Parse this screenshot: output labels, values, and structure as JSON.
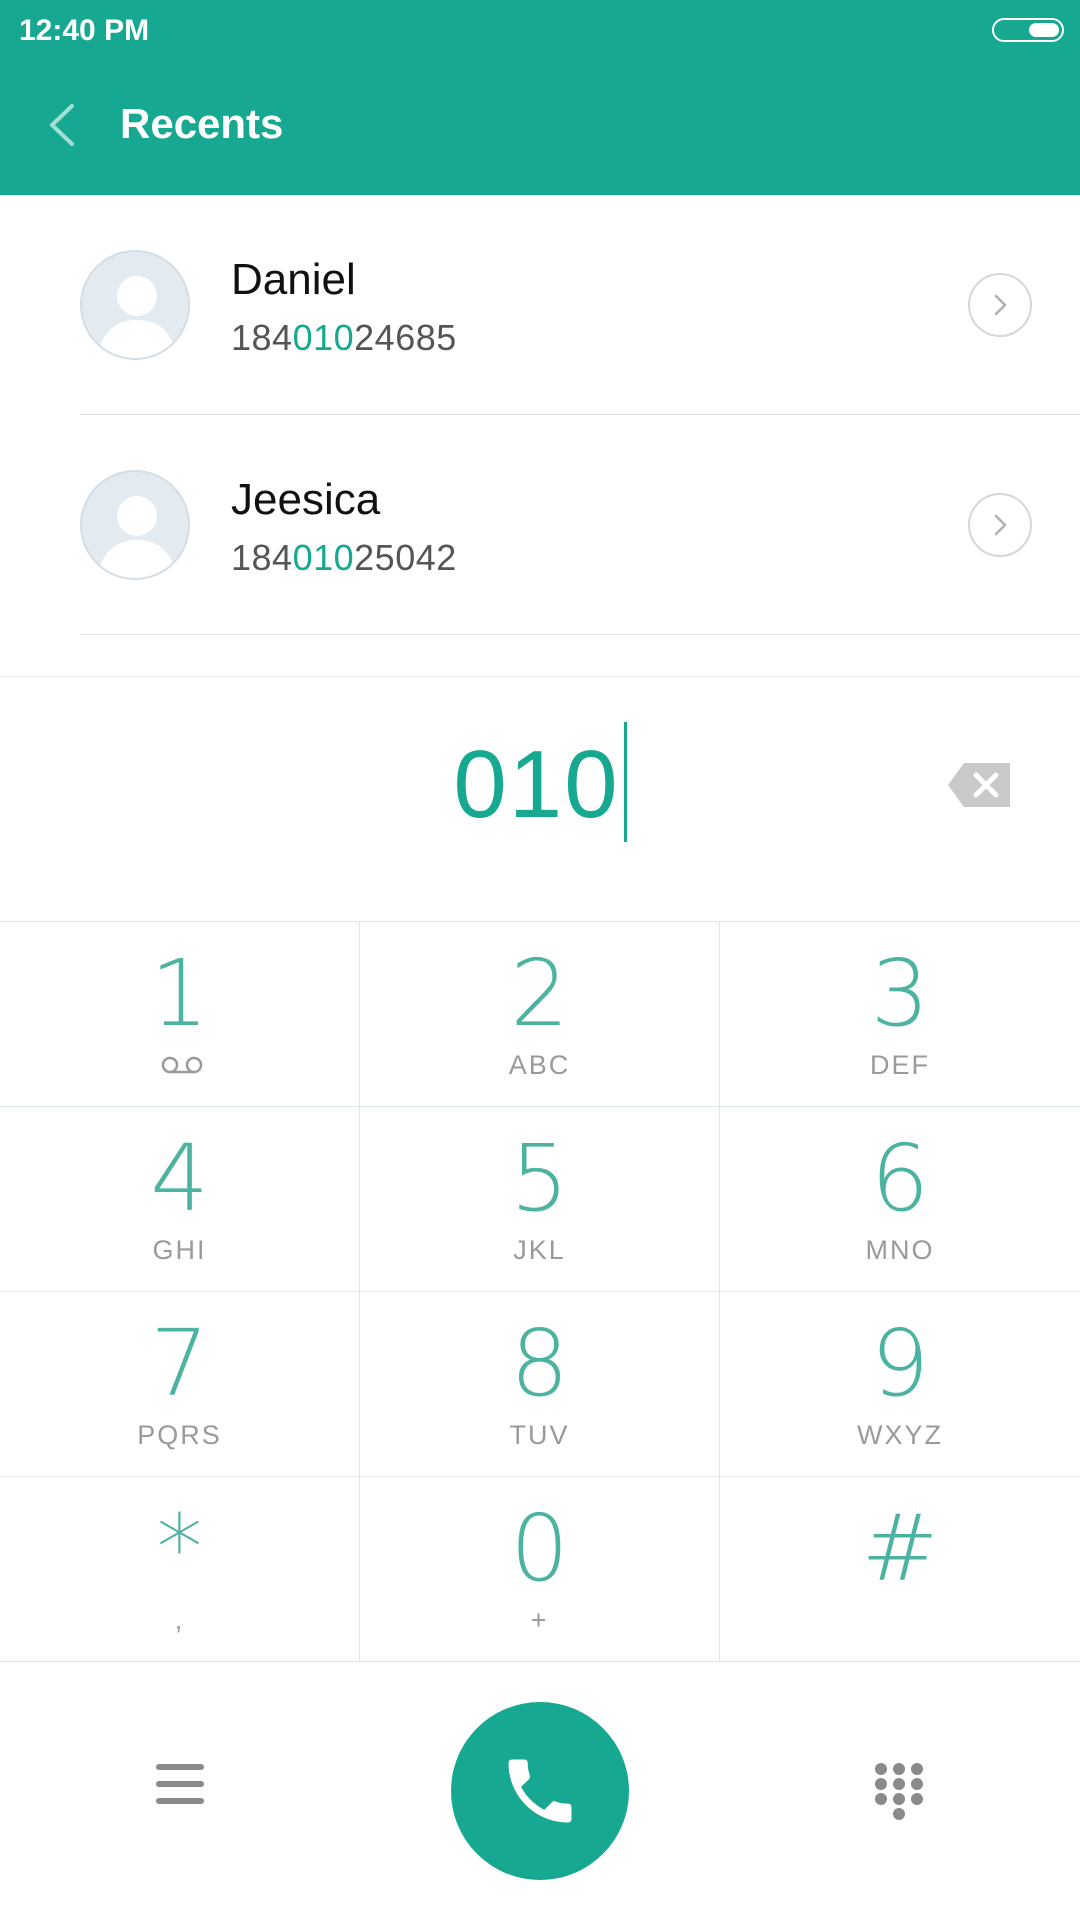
{
  "status_bar": {
    "time": "12:40 PM"
  },
  "header": {
    "title": "Recents"
  },
  "recents": [
    {
      "name": "Daniel",
      "number_prefix": "184",
      "number_match": "010",
      "number_suffix": "24685"
    },
    {
      "name": "Jeesica",
      "number_prefix": "184",
      "number_match": "010",
      "number_suffix": "25042"
    }
  ],
  "dialed": {
    "number": "010"
  },
  "keypad": [
    {
      "digit": "1",
      "letters": ""
    },
    {
      "digit": "2",
      "letters": "ABC"
    },
    {
      "digit": "3",
      "letters": "DEF"
    },
    {
      "digit": "4",
      "letters": "GHI"
    },
    {
      "digit": "5",
      "letters": "JKL"
    },
    {
      "digit": "6",
      "letters": "MNO"
    },
    {
      "digit": "7",
      "letters": "PQRS"
    },
    {
      "digit": "8",
      "letters": "TUV"
    },
    {
      "digit": "9",
      "letters": "WXYZ"
    },
    {
      "digit": "*",
      "letters": ","
    },
    {
      "digit": "0",
      "letters": "+"
    },
    {
      "digit": "#",
      "letters": ""
    }
  ],
  "colors": {
    "accent": "#16a890",
    "digit": "#4cb3a1",
    "subtext": "#9a9a9a"
  },
  "icons": {
    "back": "chevron-left-icon",
    "detail": "chevron-right-icon",
    "backspace": "backspace-icon",
    "voicemail": "voicemail-icon",
    "menu": "menu-icon",
    "call": "phone-icon",
    "keypad": "dialpad-icon"
  }
}
